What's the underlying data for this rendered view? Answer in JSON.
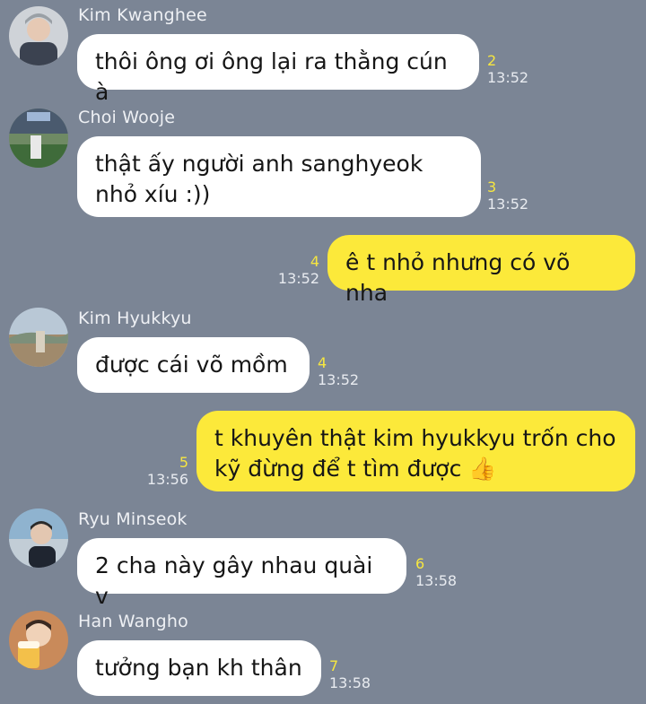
{
  "messages": [
    {
      "sender": "Kim Kwanghee",
      "text": "thôi ông ơi ông lại ra thằng cún à",
      "count": "2",
      "time": "13:52"
    },
    {
      "sender": "Choi Wooje",
      "text": "thật ấy người anh sanghyeok\nnhỏ xíu :))",
      "count": "3",
      "time": "13:52"
    },
    {
      "sender": "",
      "text": "ê t nhỏ nhưng có võ nha",
      "count": "4",
      "time": "13:52"
    },
    {
      "sender": "Kim Hyukkyu",
      "text": "được cái võ mồm",
      "count": "4",
      "time": "13:52"
    },
    {
      "sender": "",
      "text": "t khuyên thật kim hyukkyu trốn cho\nkỹ đừng để t tìm được 👍",
      "count": "5",
      "time": "13:56"
    },
    {
      "sender": "Ryu Minseok",
      "text": "2 cha này gây nhau quài v",
      "count": "6",
      "time": "13:58"
    },
    {
      "sender": "Han Wangho",
      "text": "tưởng bạn kh thân",
      "count": "7",
      "time": "13:58"
    }
  ],
  "colors": {
    "background": "#7b8595",
    "incoming": "#ffffff",
    "outgoing": "#fce93a",
    "unread": "#f6e640"
  }
}
